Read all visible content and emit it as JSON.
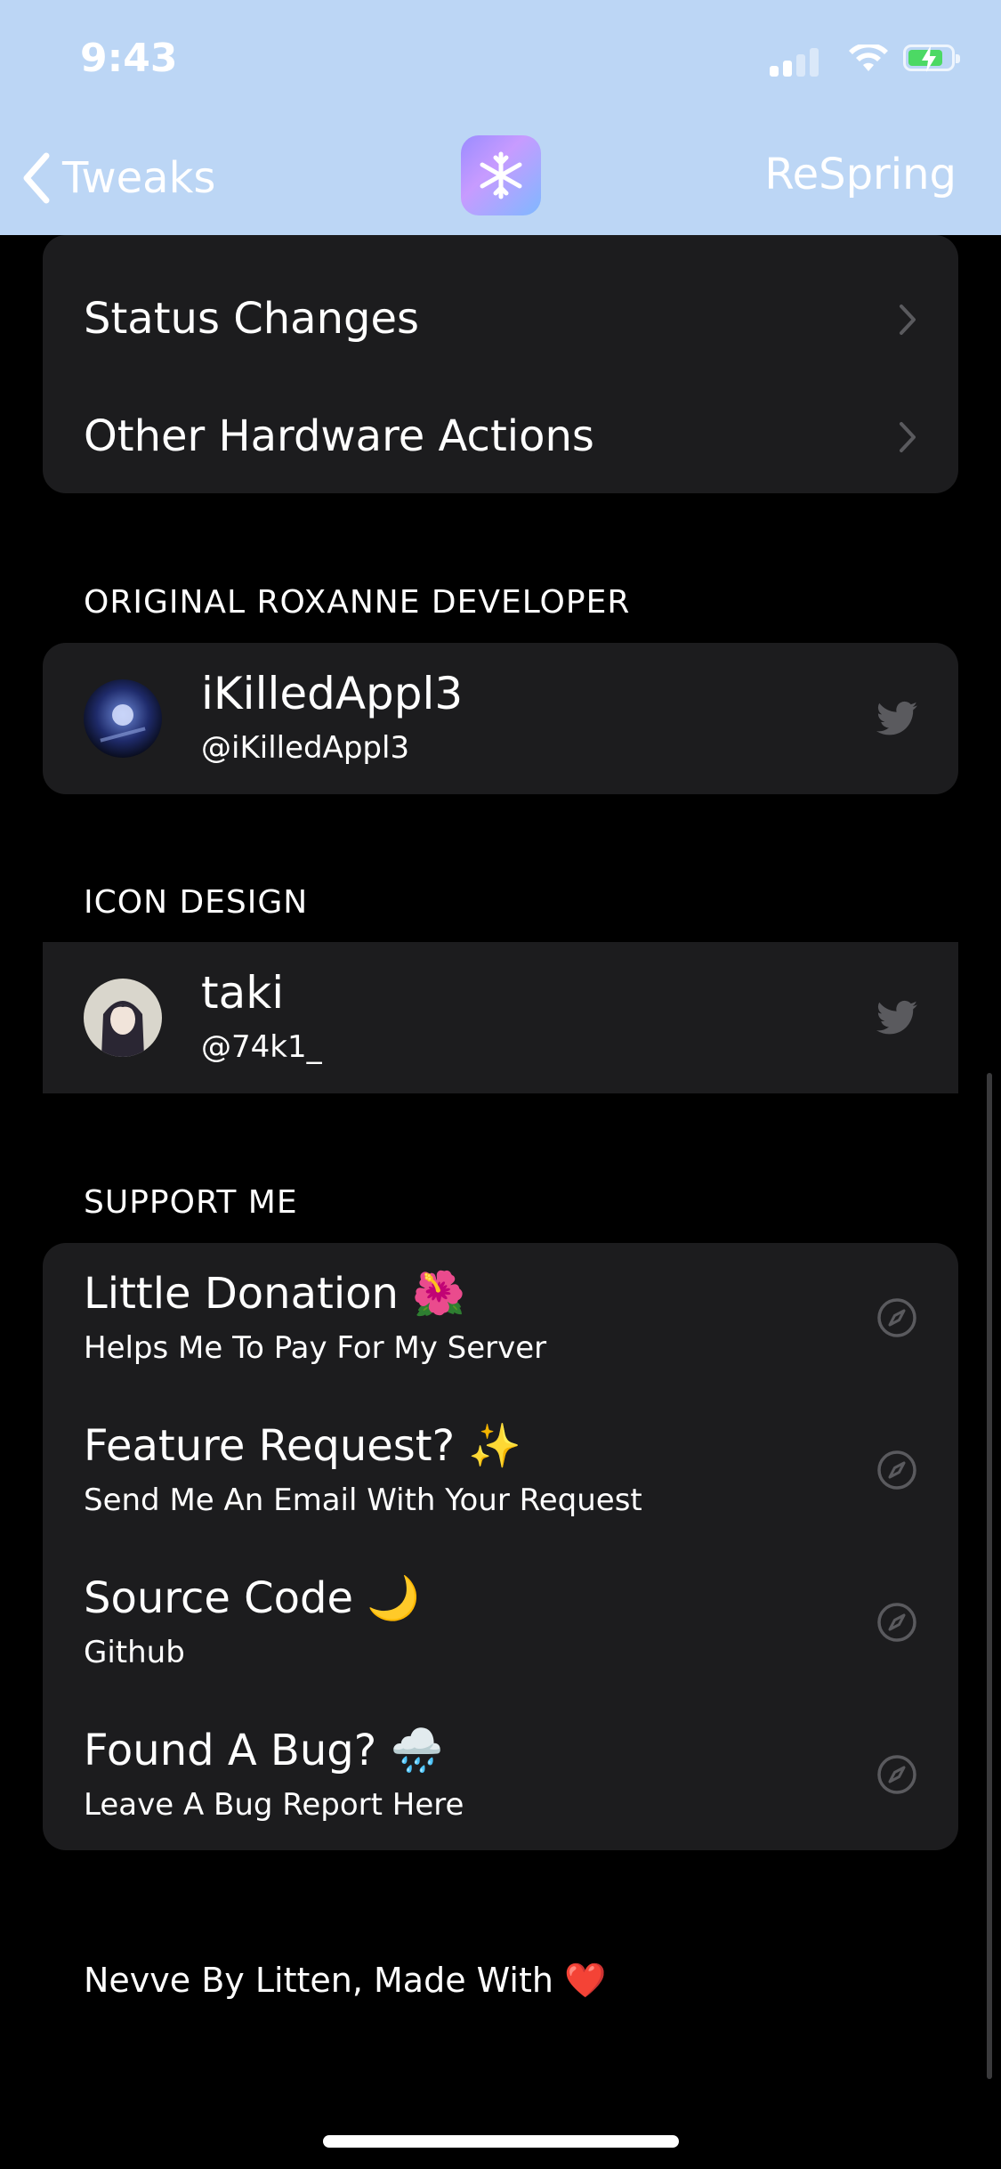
{
  "status_bar": {
    "time": "9:43"
  },
  "nav": {
    "back_label": "Tweaks",
    "app_icon": "snowflake-icon",
    "right_button": "ReSpring"
  },
  "colors": {
    "nav_background": "#bcd6f5",
    "cell_background": "#1c1c1e",
    "page_background": "#000000",
    "battery_green": "#4cd964"
  },
  "top_group": {
    "items": [
      {
        "label": "Status Changes"
      },
      {
        "label": "Other Hardware Actions"
      }
    ]
  },
  "developer_section": {
    "header": "ORIGINAL ROXANNE DEVELOPER",
    "name": "iKilledAppl3",
    "handle": "@iKilledAppl3"
  },
  "icon_section": {
    "header": "ICON DESIGN",
    "name": "taki",
    "handle": "@74k1_"
  },
  "support_section": {
    "header": "SUPPORT ME",
    "items": [
      {
        "title": "Little Donation 🌺",
        "subtitle": "Helps Me To Pay For My Server"
      },
      {
        "title": "Feature Request? ✨",
        "subtitle": "Send Me An Email With Your Request"
      },
      {
        "title": "Source Code 🌙",
        "subtitle": "Github"
      },
      {
        "title": "Found A Bug? 🌧️",
        "subtitle": "Leave A Bug Report Here"
      }
    ]
  },
  "footer": {
    "text": "Nevve By Litten, Made With ❤️"
  }
}
